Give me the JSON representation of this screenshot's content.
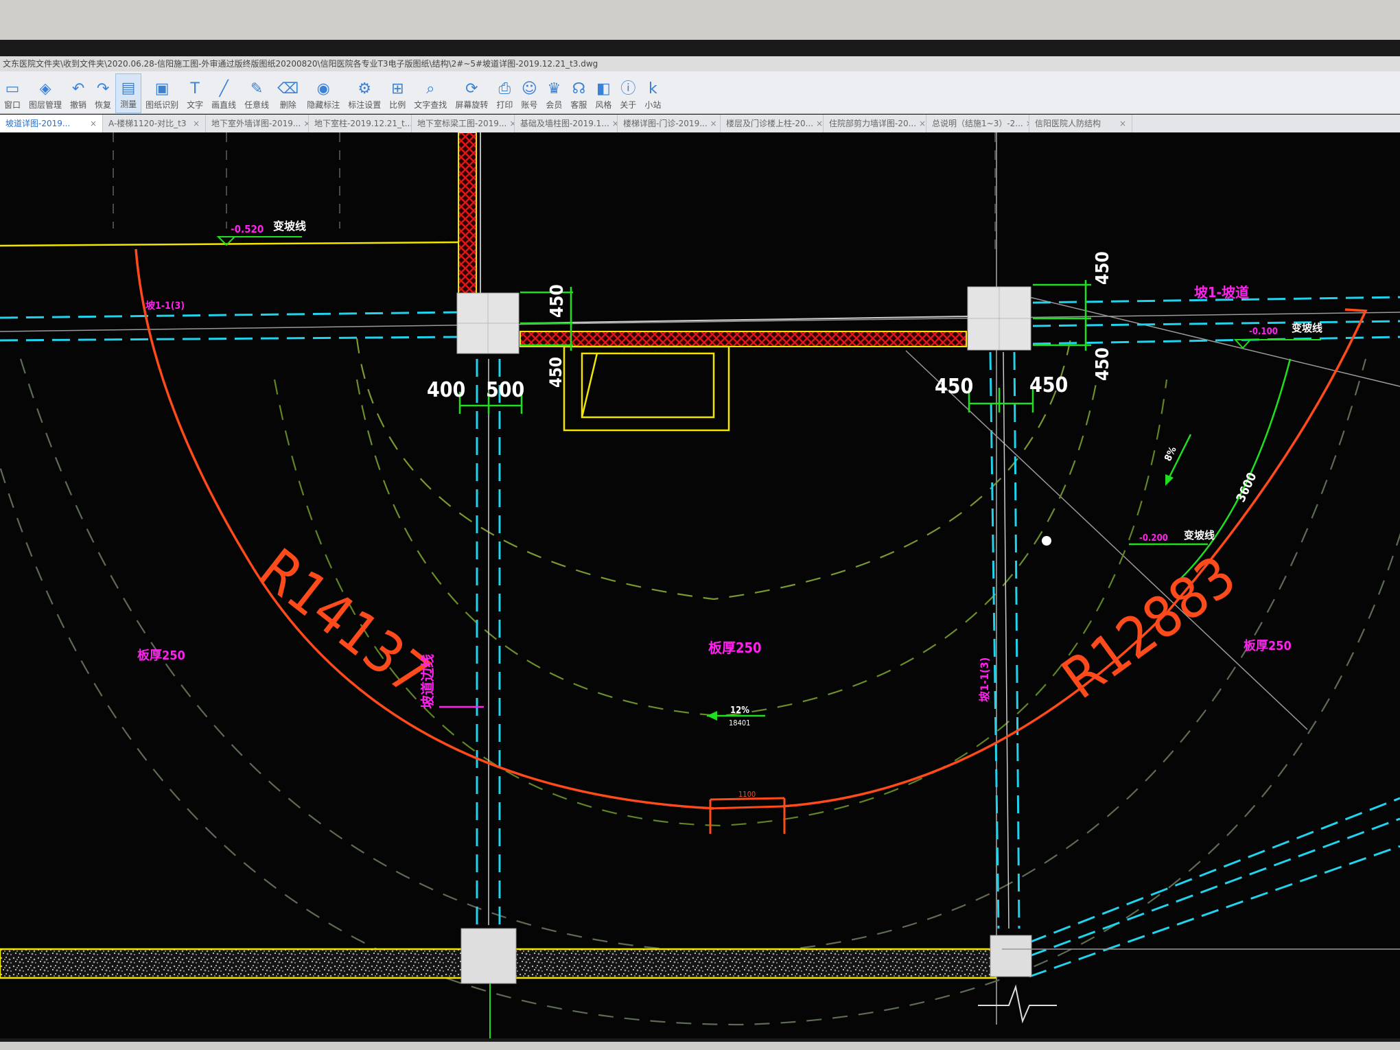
{
  "window": {
    "title_path": "文东医院文件夹\\收到文件夹\\2020.06.28-信阳施工图-外审通过版终版图纸20200820\\信阳医院各专业T3电子版图纸\\结构\\2#~5#坡道详图-2019.12.21_t3.dwg"
  },
  "toolbar": {
    "items": [
      {
        "label": "窗口",
        "icon": "window-icon"
      },
      {
        "label": "图层管理",
        "icon": "layers-icon"
      },
      {
        "label": "撤销",
        "icon": "undo-icon"
      },
      {
        "label": "恢复",
        "icon": "redo-icon"
      },
      {
        "label": "测量",
        "icon": "measure-icon"
      },
      {
        "label": "图纸识别",
        "icon": "image-recognize-icon"
      },
      {
        "label": "文字",
        "icon": "text-icon"
      },
      {
        "label": "画直线",
        "icon": "line-icon"
      },
      {
        "label": "任意线",
        "icon": "pencil-icon"
      },
      {
        "label": "删除",
        "icon": "eraser-icon"
      },
      {
        "label": "隐藏标注",
        "icon": "eye-icon"
      },
      {
        "label": "标注设置",
        "icon": "annotation-settings-icon"
      },
      {
        "label": "比例",
        "icon": "scale-icon"
      },
      {
        "label": "文字查找",
        "icon": "text-search-icon"
      },
      {
        "label": "屏幕旋转",
        "icon": "rotate-icon"
      },
      {
        "label": "打印",
        "icon": "print-icon"
      },
      {
        "label": "账号",
        "icon": "user-icon"
      },
      {
        "label": "会员",
        "icon": "vip-icon"
      },
      {
        "label": "客服",
        "icon": "headset-icon"
      },
      {
        "label": "风格",
        "icon": "style-icon"
      },
      {
        "label": "关于",
        "icon": "info-icon"
      },
      {
        "label": "小站",
        "icon": "k-logo-icon"
      }
    ],
    "active_index": 4
  },
  "tabs": [
    {
      "label": "坡道详图-2019..."
    },
    {
      "label": "A-楼梯1120-对比_t3"
    },
    {
      "label": "地下室外墙详图-2019..."
    },
    {
      "label": "地下室柱-2019.12.21_t..."
    },
    {
      "label": "地下室标梁工图-2019..."
    },
    {
      "label": "基础及墙柱图-2019.1..."
    },
    {
      "label": "楼梯详图-门诊-2019..."
    },
    {
      "label": "楼层及门诊楼上柱-20..."
    },
    {
      "label": "住院部剪力墙详图-20..."
    },
    {
      "label": "总说明（结施1~3）-2..."
    },
    {
      "label": "信阳医院人防结构"
    }
  ],
  "drawing": {
    "dims": {
      "d400": "400",
      "d500": "500",
      "d450_top_left": "450",
      "d450_side_left": "450",
      "d450_right_top": "450",
      "d450_right_bottom": "450",
      "d450_col_left": "450",
      "d450_col_right": "450",
      "d1100": "1100",
      "d3600": "3600"
    },
    "texts": {
      "elev_top_left": "-0.520",
      "change_line_top_left": "变坡线",
      "section_top_left": "坡1-1(3)",
      "radius_left": "R14137",
      "radius_right": "R12883",
      "slab_left": "板厚250",
      "slab_center": "板厚250",
      "slab_right": "板厚250",
      "slope_center": "12%",
      "slope_center_sub": "18401",
      "magenta_top_right": "坡1-坡道",
      "elev_top_right": "-0.100",
      "change_line_top_right": "变坡线",
      "elev_mid_right": "-0.200",
      "change_line_mid_right": "变坡线",
      "slope_right": "8%",
      "side_label_left": "坡道边线",
      "side_label_right": "坡1-1(3)"
    }
  },
  "colors": {
    "curve_red": "#ff4a1c",
    "dim_green": "#1fe01f",
    "cyan": "#22d3ee",
    "magenta": "#ff22ee",
    "yellow": "#f2e600",
    "hatch_red": "#e0161a"
  }
}
